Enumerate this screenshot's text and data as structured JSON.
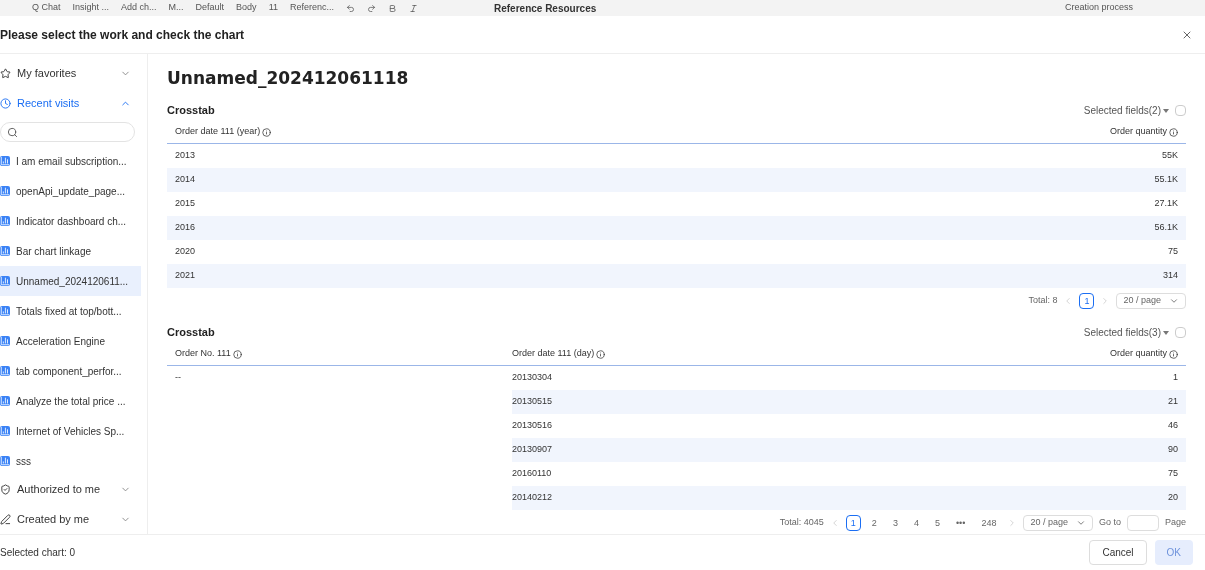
{
  "toolbar": {
    "items": [
      "Q Chat",
      "Insight ...",
      "Add ch...",
      "M...",
      "Default",
      "Body",
      "11",
      "Referenc..."
    ],
    "side_title": "Reference Resources",
    "side_link": "Creation process"
  },
  "dialog": {
    "title": "Please select the work and check the chart"
  },
  "sidebar": {
    "sections_top": [
      {
        "label": "My favorites",
        "expanded": false,
        "selected": false
      },
      {
        "label": "Recent visits",
        "expanded": true,
        "selected": true
      }
    ],
    "items": [
      {
        "label": "I am email subscription...",
        "selected": false
      },
      {
        "label": "openApi_update_page...",
        "selected": false
      },
      {
        "label": "Indicator dashboard ch...",
        "selected": false
      },
      {
        "label": "Bar chart linkage",
        "selected": false
      },
      {
        "label": "Unnamed_2024120611...",
        "selected": true
      },
      {
        "label": "Totals fixed at top/bott...",
        "selected": false
      },
      {
        "label": "Acceleration Engine",
        "selected": false
      },
      {
        "label": "tab component_perfor...",
        "selected": false
      },
      {
        "label": "Analyze the total price ...",
        "selected": false
      },
      {
        "label": "Internet of Vehicles Sp...",
        "selected": false
      },
      {
        "label": "sss",
        "selected": false
      }
    ],
    "sections_bottom": [
      {
        "label": "Authorized to me",
        "expanded": false,
        "kind": "shield"
      },
      {
        "label": "Created by me",
        "expanded": false,
        "kind": "pen"
      }
    ]
  },
  "work": {
    "title": "Unnamed_202412061118",
    "tables": [
      {
        "title": "Crosstab",
        "fields": "Selected fields(2)",
        "checked": false,
        "columns": [
          "Order date 111 (year)",
          "Order quantity"
        ],
        "rows": [
          [
            "2013",
            "55K"
          ],
          [
            "2014",
            "55.1K"
          ],
          [
            "2015",
            "27.1K"
          ],
          [
            "2016",
            "56.1K"
          ],
          [
            "2020",
            "75"
          ],
          [
            "2021",
            "314"
          ]
        ],
        "pagination": {
          "total": "Total: 8",
          "pages": [
            {
              "label": "1",
              "selected": true
            }
          ],
          "size": "20 / page"
        }
      },
      {
        "title": "Crosstab",
        "fields": "Selected fields(3)",
        "checked": false,
        "columns": [
          "Order No. 111",
          "Order date 111 (day)",
          "Order quantity"
        ],
        "rows": [
          [
            "--",
            "20130304",
            "1"
          ],
          [
            "",
            "20130515",
            "21"
          ],
          [
            "",
            "20130516",
            "46"
          ],
          [
            "",
            "20130907",
            "90"
          ],
          [
            "",
            "20160110",
            "75"
          ],
          [
            "",
            "20140212",
            "20"
          ]
        ],
        "pagination": {
          "total": "Total: 4045",
          "pages": [
            {
              "label": "1",
              "selected": true
            },
            {
              "label": "2",
              "selected": false
            },
            {
              "label": "3",
              "selected": false
            },
            {
              "label": "4",
              "selected": false
            },
            {
              "label": "5",
              "selected": false
            },
            {
              "label": "•••",
              "selected": false
            },
            {
              "label": "248",
              "selected": false
            }
          ],
          "size": "20 / page",
          "goto": "Go to",
          "page": "Page"
        }
      }
    ]
  },
  "footer": {
    "status": "Selected chart: 0",
    "cancel": "Cancel",
    "ok": "OK",
    "ok_disabled": true
  }
}
